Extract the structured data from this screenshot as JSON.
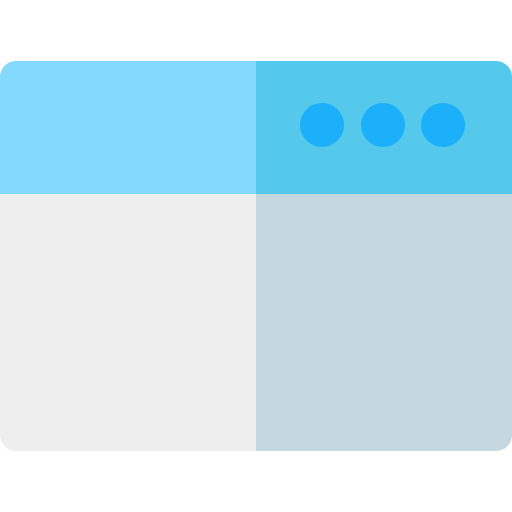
{
  "icon": {
    "name": "browser-window-icon",
    "colors": {
      "titlebar_left": "#84D9FF",
      "titlebar_right": "#55C9EC",
      "dots": "#1CB0FA",
      "body_left": "#EEEEEE",
      "body_right": "#C5D8E0"
    },
    "dot_count": 3
  }
}
